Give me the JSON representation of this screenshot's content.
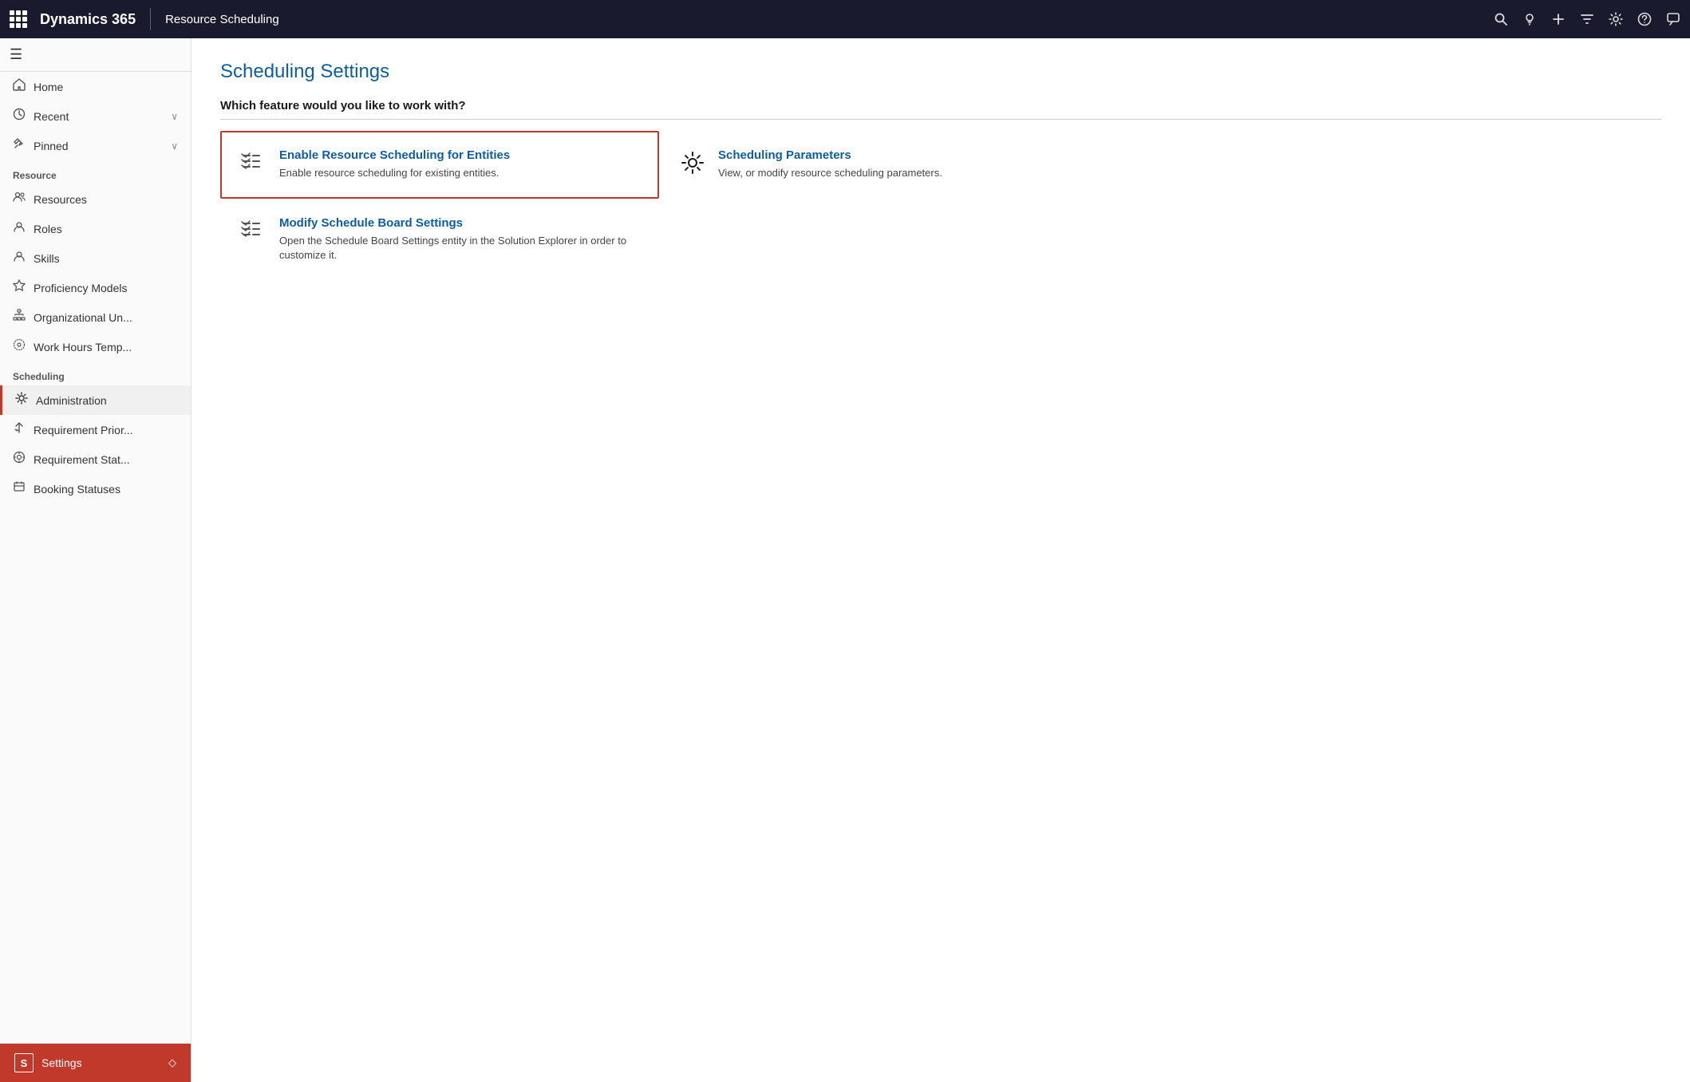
{
  "topbar": {
    "app_name": "Dynamics 365",
    "module_name": "Resource Scheduling",
    "icons": [
      "search",
      "lightbulb",
      "plus",
      "filter",
      "settings",
      "help",
      "chat"
    ]
  },
  "sidebar": {
    "hamburger_label": "☰",
    "nav_items_top": [
      {
        "id": "home",
        "label": "Home",
        "icon": "⌂"
      },
      {
        "id": "recent",
        "label": "Recent",
        "icon": "🕐",
        "has_chevron": true
      },
      {
        "id": "pinned",
        "label": "Pinned",
        "icon": "☆",
        "has_chevron": true
      }
    ],
    "section_resource": "Resource",
    "nav_items_resource": [
      {
        "id": "resources",
        "label": "Resources",
        "icon": "⊞"
      },
      {
        "id": "roles",
        "label": "Roles",
        "icon": "⊟"
      },
      {
        "id": "skills",
        "label": "Skills",
        "icon": "⊟"
      },
      {
        "id": "proficiency",
        "label": "Proficiency Models",
        "icon": "★"
      },
      {
        "id": "org",
        "label": "Organizational Un...",
        "icon": "⊠"
      },
      {
        "id": "workhours",
        "label": "Work Hours Temp...",
        "icon": "⊙"
      }
    ],
    "section_scheduling": "Scheduling",
    "nav_items_scheduling": [
      {
        "id": "administration",
        "label": "Administration",
        "icon": "⚙",
        "active": true
      },
      {
        "id": "req_priority",
        "label": "Requirement Prior...",
        "icon": "↕"
      },
      {
        "id": "req_status",
        "label": "Requirement Stat...",
        "icon": "⊛"
      },
      {
        "id": "booking",
        "label": "Booking Statuses",
        "icon": "⊟"
      }
    ],
    "settings_label": "Settings",
    "settings_avatar": "S",
    "settings_chevron": "◇"
  },
  "content": {
    "title": "Scheduling Settings",
    "section_question": "Which feature would you like to work with?",
    "feature_cards": [
      {
        "id": "enable-scheduling",
        "title": "Enable Resource Scheduling for Entities",
        "description": "Enable resource scheduling for existing entities.",
        "icon_type": "checklist",
        "selected": true
      },
      {
        "id": "scheduling-parameters",
        "title": "Scheduling Parameters",
        "description": "View, or modify resource scheduling parameters.",
        "icon_type": "gear",
        "selected": false
      },
      {
        "id": "modify-board-settings",
        "title": "Modify Schedule Board Settings",
        "description": "Open the Schedule Board Settings entity in the Solution Explorer in order to customize it.",
        "icon_type": "checklist",
        "selected": false
      }
    ]
  }
}
